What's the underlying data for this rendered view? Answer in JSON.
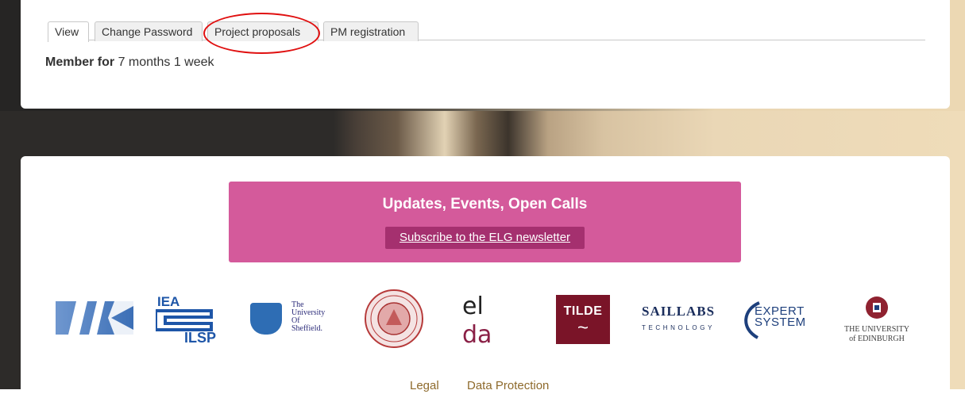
{
  "tabs": [
    {
      "label": "View",
      "active": true
    },
    {
      "label": "Change Password",
      "active": false
    },
    {
      "label": "Project proposals",
      "active": false,
      "highlighted": true
    },
    {
      "label": "PM registration",
      "active": false
    }
  ],
  "member": {
    "label": "Member for",
    "value": "7 months 1 week"
  },
  "newsletter": {
    "title": "Updates, Events, Open Calls",
    "link": "Subscribe to the ELG newsletter",
    "bg_color": "#d45a9b",
    "link_bg_color": "#a5306f"
  },
  "logos": {
    "ilsp": {
      "text1": "IEA",
      "text2": "ILSP"
    },
    "sheffield": {
      "line1": "The",
      "line2": "University",
      "line3": "Of",
      "line4": "Sheffield."
    },
    "elda": {
      "text1": "el",
      "text2": "da"
    },
    "tilde": {
      "text": "TILDE"
    },
    "saillabs": {
      "text1": "SAILLABS",
      "text2": "TECHNOLOGY"
    },
    "expert": {
      "line1": "EXPERT",
      "line2": "SYSTEM"
    },
    "edinburgh": {
      "line1": "THE UNIVERSITY",
      "line2": "of EDINBURGH"
    }
  },
  "footer": {
    "legal": "Legal",
    "data_protection": "Data Protection"
  },
  "colors": {
    "annotation": "#e01010",
    "footer_link": "#8e6a2c"
  }
}
